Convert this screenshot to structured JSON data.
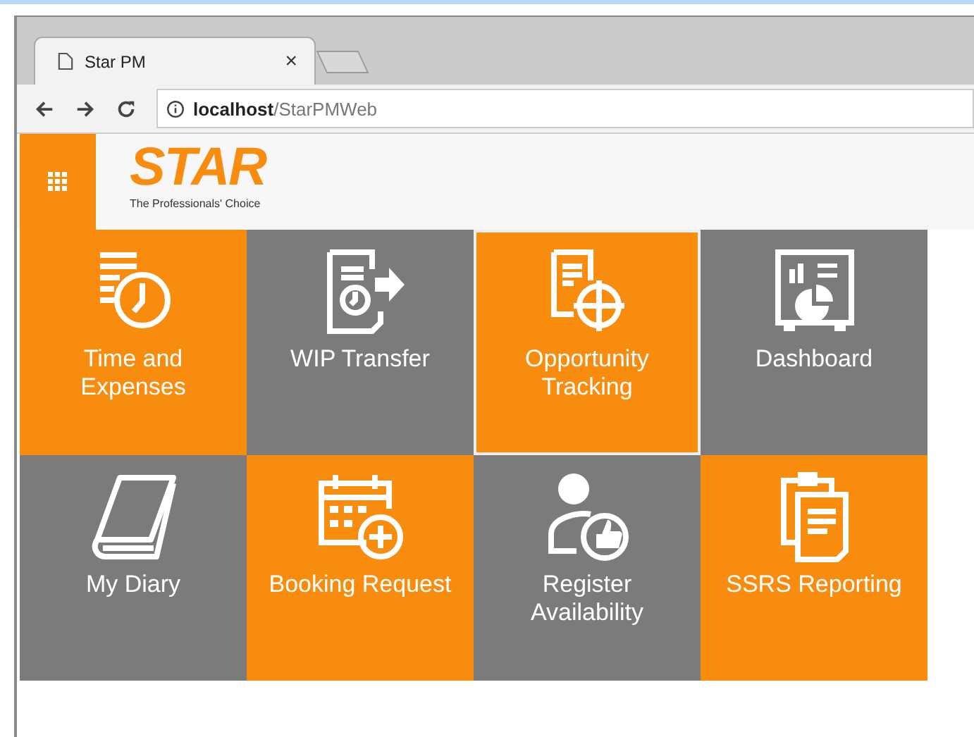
{
  "browser": {
    "tab_title": "Star PM",
    "tab_close": "×",
    "address_host": "localhost",
    "address_path": "/StarPMWeb"
  },
  "header": {
    "logo": "STAR",
    "tagline": "The Professionals' Choice"
  },
  "tiles": [
    {
      "kind": "time",
      "label": "Time and Expenses",
      "color": "#f88c0e",
      "selected": false
    },
    {
      "kind": "transfer",
      "label": "WIP Transfer",
      "color": "#7b7b7b",
      "selected": false
    },
    {
      "kind": "target",
      "label": "Opportunity Tracking",
      "color": "#f88c0e",
      "selected": true
    },
    {
      "kind": "dashboard",
      "label": "Dashboard",
      "color": "#7b7b7b",
      "selected": false
    },
    {
      "kind": "book",
      "label": "My Diary",
      "color": "#7b7b7b",
      "selected": false
    },
    {
      "kind": "calendar",
      "label": "Booking Request",
      "color": "#f88c0e",
      "selected": false
    },
    {
      "kind": "person",
      "label": "Register Availability",
      "color": "#7b7b7b",
      "selected": false
    },
    {
      "kind": "report",
      "label": "SSRS Reporting",
      "color": "#f88c0e",
      "selected": false
    }
  ]
}
